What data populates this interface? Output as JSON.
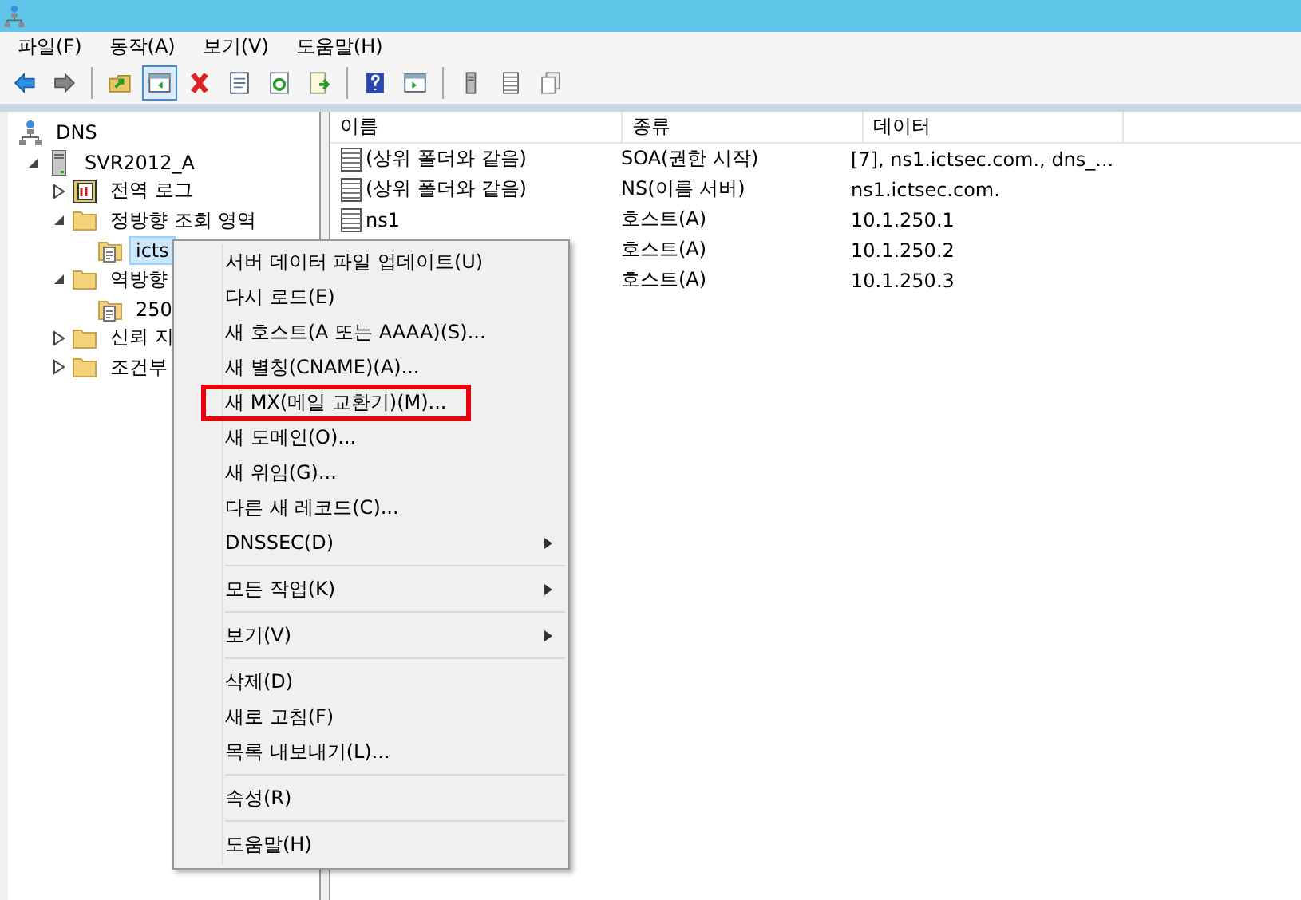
{
  "menu_bar": [
    {
      "label": "파일(F)"
    },
    {
      "label": "동작(A)"
    },
    {
      "label": "보기(V)"
    },
    {
      "label": "도움말(H)"
    }
  ],
  "toolbar": [
    {
      "kind": "back",
      "pressed": false
    },
    {
      "kind": "forward",
      "pressed": false
    },
    {
      "kind": "separator"
    },
    {
      "kind": "up",
      "pressed": false
    },
    {
      "kind": "tree-toggle",
      "pressed": true
    },
    {
      "kind": "delete",
      "pressed": false
    },
    {
      "kind": "properties",
      "pressed": false
    },
    {
      "kind": "refresh",
      "pressed": false
    },
    {
      "kind": "export",
      "pressed": false
    },
    {
      "kind": "separator"
    },
    {
      "kind": "help",
      "pressed": false
    },
    {
      "kind": "action-pane",
      "pressed": false
    },
    {
      "kind": "separator"
    },
    {
      "kind": "server",
      "pressed": false
    },
    {
      "kind": "list",
      "pressed": false
    },
    {
      "kind": "copy",
      "pressed": false
    }
  ],
  "tree": [
    {
      "label": "DNS",
      "kind": "dns",
      "selected": false,
      "children": [
        {
          "label": "SVR2012_A",
          "kind": "server",
          "expanded": true,
          "selected": false,
          "children": [
            {
              "label": "전역 로그",
              "kind": "log",
              "expanded": false,
              "selected": false
            },
            {
              "label": "정방향 조회 영역",
              "kind": "folder",
              "expanded": true,
              "selected": false,
              "children": [
                {
                  "label": "icts",
                  "kind": "zone",
                  "selected": true
                }
              ]
            },
            {
              "label": "역방향",
              "kind": "folder",
              "expanded": true,
              "selected": false,
              "children": [
                {
                  "label": "250",
                  "kind": "zone",
                  "selected": false
                }
              ]
            },
            {
              "label": "신뢰 지",
              "kind": "folder",
              "expanded": false,
              "selected": false
            },
            {
              "label": "조건부",
              "kind": "folder",
              "expanded": false,
              "selected": false
            }
          ]
        }
      ]
    }
  ],
  "table": {
    "columns": [
      "이름",
      "종류",
      "데이터"
    ],
    "rows": [
      {
        "name": "(상위 폴더와 같음)",
        "type": "SOA(권한 시작)",
        "data": "[7], ns1.ictsec.com., dns_..."
      },
      {
        "name": "(상위 폴더와 같음)",
        "type": "NS(이름 서버)",
        "data": "ns1.ictsec.com."
      },
      {
        "name": "ns1",
        "type": "호스트(A)",
        "data": "10.1.250.1"
      },
      {
        "type": "호스트(A)",
        "data": "10.1.250.2"
      },
      {
        "type": "호스트(A)",
        "data": "10.1.250.3"
      }
    ]
  },
  "context_menu": [
    {
      "kind": "item",
      "label": "서버 데이터 파일 업데이트(U)",
      "marked": false
    },
    {
      "kind": "item",
      "label": "다시 로드(E)",
      "marked": false
    },
    {
      "kind": "item",
      "label": "새 호스트(A 또는 AAAA)(S)...",
      "marked": false
    },
    {
      "kind": "item",
      "label": "새 별칭(CNAME)(A)...",
      "marked": false
    },
    {
      "kind": "item",
      "label": "새 MX(메일 교환기)(M)...",
      "marked": true
    },
    {
      "kind": "item",
      "label": "새 도메인(O)...",
      "marked": false
    },
    {
      "kind": "item",
      "label": "새 위임(G)...",
      "marked": false
    },
    {
      "kind": "item",
      "label": "다른 새 레코드(C)...",
      "marked": false
    },
    {
      "kind": "submenu",
      "label": "DNSSEC(D)",
      "marked": false
    },
    {
      "kind": "separator"
    },
    {
      "kind": "submenu",
      "label": "모든 작업(K)",
      "marked": false
    },
    {
      "kind": "separator"
    },
    {
      "kind": "submenu",
      "label": "보기(V)",
      "marked": false
    },
    {
      "kind": "separator"
    },
    {
      "kind": "item",
      "label": "삭제(D)",
      "marked": false
    },
    {
      "kind": "item",
      "label": "새로 고침(F)",
      "marked": false
    },
    {
      "kind": "item",
      "label": "목록 내보내기(L)...",
      "marked": false
    },
    {
      "kind": "separator"
    },
    {
      "kind": "item",
      "label": "속성(R)",
      "marked": false
    },
    {
      "kind": "separator"
    },
    {
      "kind": "item",
      "label": "도움말(H)",
      "marked": false
    }
  ]
}
